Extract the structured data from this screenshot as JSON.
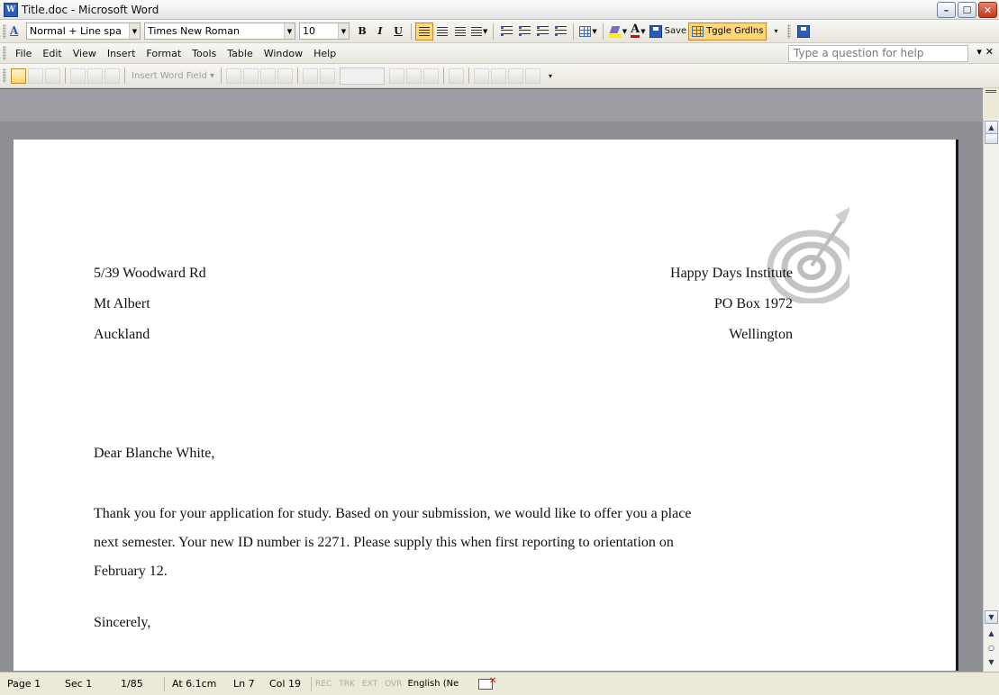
{
  "window": {
    "title": "Title.doc - Microsoft Word",
    "app_icon_letter": "W",
    "controls": {
      "minimize": "–",
      "maximize": "☐",
      "close": "✕"
    }
  },
  "formatting_toolbar": {
    "style_value": "Normal + Line spa",
    "font_value": "Times New Roman",
    "size_value": "10",
    "bold": "B",
    "italic": "I",
    "underline": "U",
    "font_color_glyph": "A",
    "save_label": "Save",
    "toggle_gridlines_label": "Tggle Grdlns"
  },
  "menu_bar": {
    "items": [
      "File",
      "Edit",
      "View",
      "Insert",
      "Format",
      "Tools",
      "Table",
      "Window",
      "Help"
    ],
    "help_placeholder": "Type a question for help",
    "close_glyph": "▾ ✕"
  },
  "mail_merge_toolbar": {
    "insert_word_field": "Insert Word Field ▾"
  },
  "document": {
    "sender": [
      "5/39 Woodward Rd",
      "Mt Albert",
      "Auckland"
    ],
    "recipient": [
      "Happy Days Institute",
      "PO Box 1972",
      "Wellington"
    ],
    "salutation": "Dear Blanche White,",
    "body": [
      "Thank you for your application for study. Based on your submission, we would like to offer you a place",
      "next semester. Your new ID number is 2271. Please supply this when first reporting to orientation on",
      "February 12."
    ],
    "closing": "Sincerely,"
  },
  "status_bar": {
    "page": "Page 1",
    "section": "Sec 1",
    "page_of": "1/85",
    "at": "At 6.1cm",
    "line": "Ln 7",
    "col": "Col 19",
    "rec": "REC",
    "trk": "TRK",
    "ext": "EXT",
    "ovr": "OVR",
    "language": "English (Ne"
  },
  "colors": {
    "workspace": "#8e8f94",
    "active_button": "#ffd774",
    "title_icon": "#2a5cb8"
  }
}
